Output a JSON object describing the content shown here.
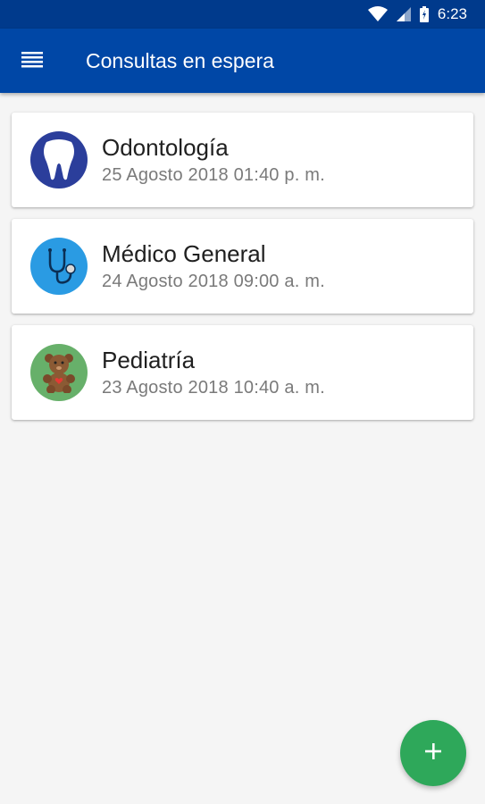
{
  "status_bar": {
    "time": "6:23"
  },
  "app_bar": {
    "title": "Consultas en espera"
  },
  "appointments": [
    {
      "specialty": "Odontología",
      "date": "25 Agosto 2018 01:40 p. m.",
      "icon": "tooth-icon",
      "color": "#2b3e9b"
    },
    {
      "specialty": "Médico General",
      "date": "24 Agosto 2018 09:00 a. m.",
      "icon": "stethoscope-icon",
      "color": "#2a9be3"
    },
    {
      "specialty": "Pediatría",
      "date": "23 Agosto 2018 10:40 a. m.",
      "icon": "teddy-bear-icon",
      "color": "#67b06a"
    }
  ],
  "fab": {
    "icon": "plus-icon",
    "color": "#2ea85a"
  },
  "colors": {
    "primary": "#0047a6",
    "primary_dark": "#003a8c"
  }
}
